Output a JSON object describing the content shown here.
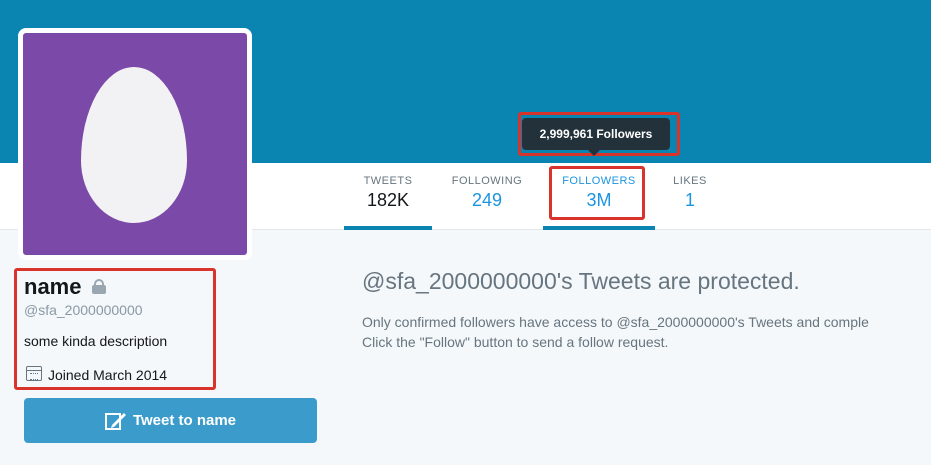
{
  "tooltip": {
    "text": "2,999,961 Followers"
  },
  "stats": [
    {
      "label": "TWEETS",
      "value": "182K"
    },
    {
      "label": "FOLLOWING",
      "value": "249"
    },
    {
      "label": "FOLLOWERS",
      "value": "3M"
    },
    {
      "label": "LIKES",
      "value": "1"
    }
  ],
  "profile": {
    "name": "name",
    "handle": "@sfa_2000000000",
    "bio": "some kinda description",
    "joined": "Joined March 2014"
  },
  "tweet_button": {
    "label": "Tweet to name"
  },
  "protected": {
    "title": "@sfa_2000000000's Tweets are protected.",
    "line1": "Only confirmed followers have access to @sfa_2000000000's Tweets and comple",
    "line2": "Click the \"Follow\" button to send a follow request."
  },
  "colors": {
    "header": "#0a84b1",
    "avatar": "#7b4aa8",
    "highlight": "#d9342b",
    "link": "#1b95e0",
    "button": "#3b9ccc"
  }
}
